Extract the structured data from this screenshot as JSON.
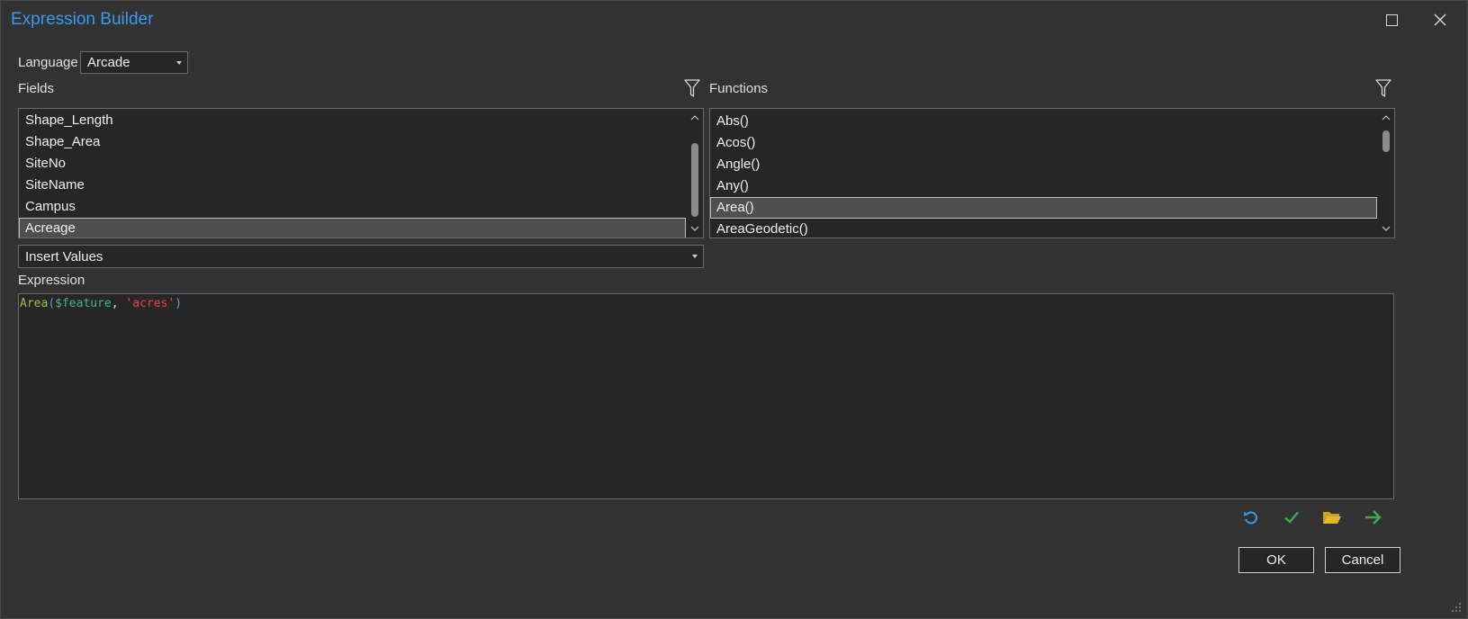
{
  "window": {
    "title": "Expression Builder"
  },
  "language": {
    "label": "Language",
    "value": "Arcade"
  },
  "fields": {
    "label": "Fields",
    "items": [
      "Shape_Length",
      "Shape_Area",
      "SiteNo",
      "SiteName",
      "Campus",
      "Acreage"
    ],
    "selected": "Acreage"
  },
  "functions": {
    "label": "Functions",
    "items": [
      "Abs()",
      "Acos()",
      "Angle()",
      "Any()",
      "Area()",
      "AreaGeodetic()"
    ],
    "selected": "Area()"
  },
  "insert_values": {
    "value": "Insert Values"
  },
  "expression": {
    "label": "Expression",
    "tokens": {
      "fn": "Area",
      "open": "(",
      "var": "$feature",
      "comma": ", ",
      "str": "'acres'",
      "close": ")"
    }
  },
  "buttons": {
    "ok": "OK",
    "cancel": "Cancel"
  },
  "colors": {
    "title": "#3a9bf0",
    "undo_icon": "#3a9bf0",
    "verify_icon": "#3fae49",
    "open_icon": "#e3b72b",
    "export_icon": "#3fae49"
  }
}
